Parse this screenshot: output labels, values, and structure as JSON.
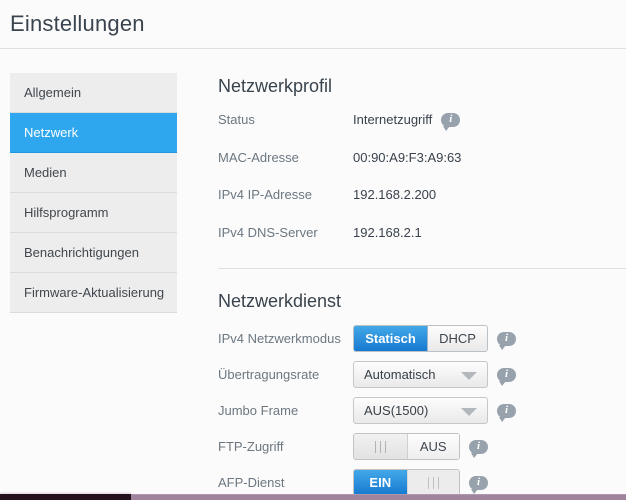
{
  "page": {
    "title": "Einstellungen"
  },
  "colors": {
    "accent_blue": "#2ea7ee",
    "button_blue_top": "#43a8e8",
    "button_blue_bottom": "#1679d0",
    "sidebar_bg": "#ededed",
    "info_icon_gray": "#98a2ac"
  },
  "icons": {
    "info_glyph": "i"
  },
  "sidebar": {
    "items": [
      {
        "label": "Allgemein",
        "selected": false
      },
      {
        "label": "Netzwerk",
        "selected": true
      },
      {
        "label": "Medien",
        "selected": false
      },
      {
        "label": "Hilfsprogramm",
        "selected": false
      },
      {
        "label": "Benachrichtigungen",
        "selected": false
      },
      {
        "label": "Firmware-Aktualisierung",
        "selected": false
      }
    ]
  },
  "profile": {
    "heading": "Netzwerkprofil",
    "rows": [
      {
        "label": "Status",
        "value": "Internetzugriff",
        "info": true
      },
      {
        "label": "MAC-Adresse",
        "value": "00:90:A9:F3:A9:63",
        "info": false
      },
      {
        "label": "IPv4 IP-Adresse",
        "value": "192.168.2.200",
        "info": false
      },
      {
        "label": "IPv4 DNS-Server",
        "value": "192.168.2.1",
        "info": false
      }
    ]
  },
  "services": {
    "heading": "Netzwerkdienst",
    "network_mode": {
      "label": "IPv4 Netzwerkmodus",
      "options": [
        "Statisch",
        "DHCP"
      ],
      "selected": "Statisch"
    },
    "transfer_rate": {
      "label": "Übertragungsrate",
      "value": "Automatisch"
    },
    "jumbo_frame": {
      "label": "Jumbo Frame",
      "value": "AUS(1500)"
    },
    "ftp_access": {
      "label": "FTP-Zugriff",
      "state": "AUS",
      "on": false
    },
    "afp_service": {
      "label": "AFP-Dienst",
      "state": "EIN",
      "on": true
    }
  }
}
